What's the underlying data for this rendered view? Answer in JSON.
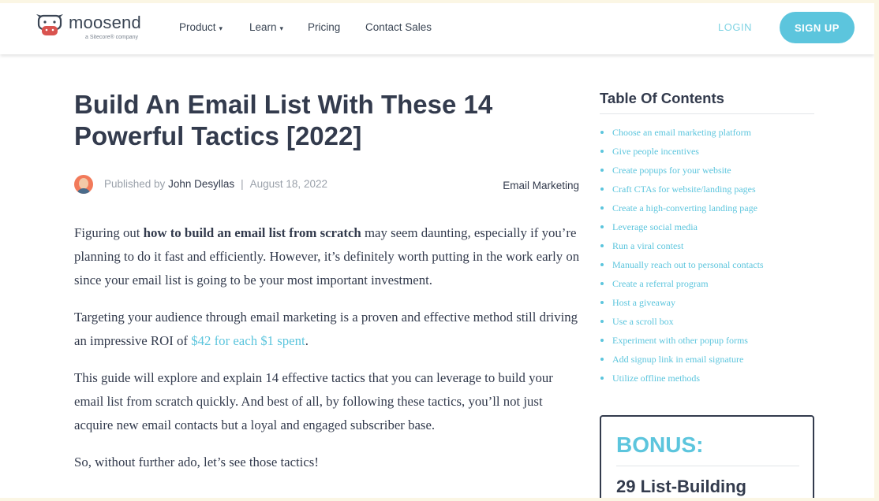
{
  "header": {
    "logo_text": "moosend",
    "logo_subtext": "a Sitecore® company",
    "nav": [
      {
        "label": "Product",
        "caret": "▾"
      },
      {
        "label": "Learn",
        "caret": "▾"
      },
      {
        "label": "Pricing",
        "caret": ""
      },
      {
        "label": "Contact Sales",
        "caret": ""
      }
    ],
    "login_label": "LOGIN",
    "signup_label": "SIGN UP"
  },
  "article": {
    "title": "Build An Email List With These 14 Powerful Tactics [2022]",
    "published_prefix": "Published by",
    "author": "John Desyllas",
    "separator": "|",
    "date": "August 18, 2022",
    "category": "Email Marketing",
    "p1_pre": "Figuring out ",
    "p1_bold": "how to build an email list from scratch",
    "p1_post": " may seem daunting, especially if you’re planning to do it fast and efficiently. However, it’s definitely worth putting in the work early on since your email list is going to be your most important investment.",
    "p2_pre": "Targeting your audience through email marketing is a proven and effective method still driving an impressive ROI of ",
    "p2_link": "$42 for each $1 spent",
    "p2_post": ".",
    "p3": "This guide will explore and explain 14 effective tactics that you can leverage to build your email list from scratch quickly. And best of all, by following these tactics, you’ll not just acquire new email contacts but a loyal and engaged subscriber base.",
    "p4": "So, without further ado, let’s see those tactics!"
  },
  "sidebar": {
    "toc_title": "Table Of Contents",
    "toc_items": [
      "Choose an email marketing platform",
      "Give people incentives",
      "Create popups for your website",
      "Craft CTAs for website/landing pages",
      "Create a high-converting landing page",
      "Leverage social media",
      "Run a viral contest",
      "Manually reach out to personal contacts",
      "Create a referral program",
      "Host a giveaway",
      "Use a scroll box",
      "Experiment with other popup forms",
      "Add signup link in email signature",
      "Utilize offline methods"
    ],
    "bonus_label": "BONUS:",
    "bonus_subtitle": "29 List-Building"
  },
  "colors": {
    "accent": "#5cc5dd",
    "text_dark": "#333b4d",
    "muted": "#9aa1aa",
    "logo_red": "#d9534f"
  }
}
